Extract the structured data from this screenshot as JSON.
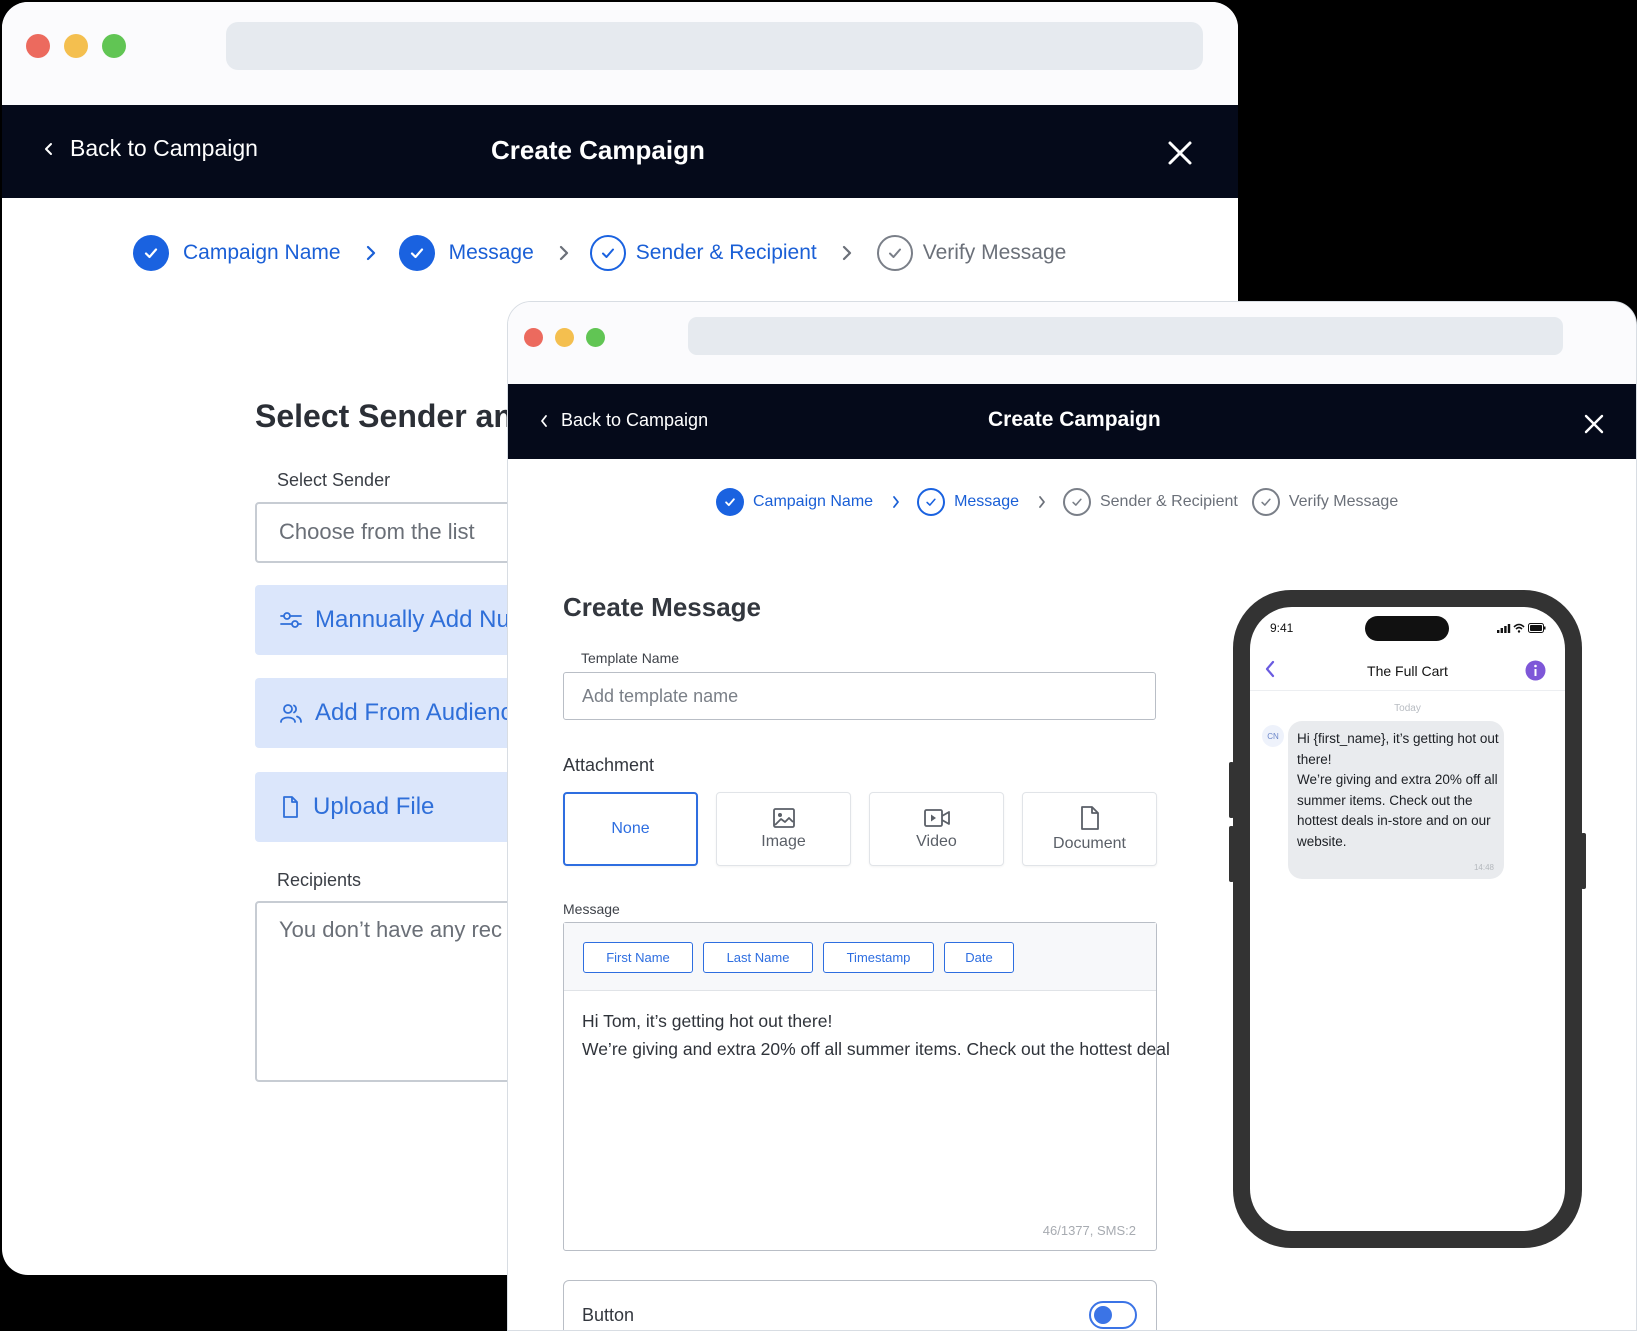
{
  "back_window": {
    "nav": {
      "back_label": "Back to Campaign",
      "title": "Create Campaign"
    },
    "steps": [
      {
        "label": "Campaign Name",
        "state": "done"
      },
      {
        "label": "Message",
        "state": "done"
      },
      {
        "label": "Sender & Recipient",
        "state": "current"
      },
      {
        "label": "Verify Message",
        "state": "pending"
      }
    ],
    "heading": "Select Sender an",
    "select_sender_label": "Select Sender",
    "select_sender_placeholder": "Choose from the list",
    "buttons": [
      {
        "label": "Mannually Add Nu",
        "icon": "sliders-icon"
      },
      {
        "label": "Add From Audienc",
        "icon": "users-icon"
      },
      {
        "label": "Upload File",
        "icon": "file-icon"
      }
    ],
    "recipients_label": "Recipients",
    "recipients_placeholder": "You don’t have any rec"
  },
  "front_window": {
    "nav": {
      "back_label": "Back to Campaign",
      "title": "Create Campaign"
    },
    "steps": [
      {
        "label": "Campaign Name",
        "state": "done"
      },
      {
        "label": "Message",
        "state": "current"
      },
      {
        "label": "Sender & Recipient",
        "state": "pending"
      },
      {
        "label": "Verify Message",
        "state": "pending"
      }
    ],
    "heading": "Create Message",
    "template_label": "Template Name",
    "template_placeholder": "Add template name",
    "attachment_label": "Attachment",
    "attachments": [
      {
        "label": "None",
        "selected": true,
        "icon": ""
      },
      {
        "label": "Image",
        "selected": false,
        "icon": "image-icon"
      },
      {
        "label": "Video",
        "selected": false,
        "icon": "video-icon"
      },
      {
        "label": "Document",
        "selected": false,
        "icon": "document-icon"
      }
    ],
    "message_label": "Message",
    "chips": [
      "First Name",
      "Last Name",
      "Timestamp",
      "Date"
    ],
    "message_line1": "Hi Tom, it’s getting hot out there!",
    "message_line2": "We’re giving and extra 20% off all summer items. Check out the hottest deal",
    "counter": "46/1377, SMS:2",
    "button_label": "Button",
    "button_toggle_on": true
  },
  "phone": {
    "time": "9:41",
    "contact": "The Full Cart",
    "day": "Today",
    "avatar": "CN",
    "bubble_text": "Hi {first_name}, it’s getting hot out there!\nWe’re giving and extra 20% off all summer items. Check out the hottest deals in-store and on our website.",
    "bubble_time": "14:48"
  },
  "colors": {
    "accent": "#1a62e0",
    "nav_bg": "#050a1a",
    "button_bg": "#dbe6fb",
    "traffic_red": "#ec6a5e",
    "traffic_yellow": "#f4bf4f",
    "traffic_green": "#61c554"
  }
}
